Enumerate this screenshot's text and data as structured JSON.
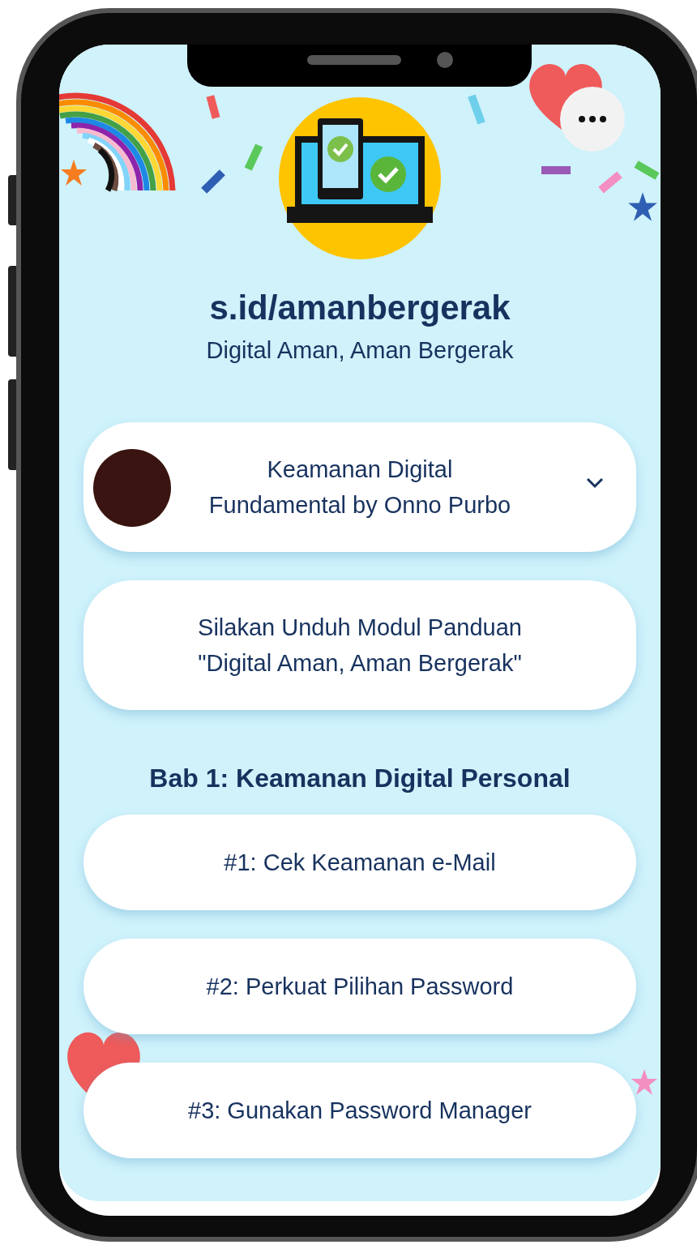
{
  "profile": {
    "handle": "s.id/amanbergerak",
    "tagline": "Digital Aman, Aman Bergerak"
  },
  "links": [
    {
      "kind": "thumbnail",
      "label": "Keamanan Digital\nFundamental by Onno Purbo",
      "expanded": false
    },
    {
      "kind": "plain",
      "label": "Silakan Unduh Modul Panduan\n\"Digital Aman, Aman Bergerak\""
    }
  ],
  "sections": [
    {
      "title": "Bab 1: Keamanan Digital Personal",
      "links": [
        {
          "kind": "plain",
          "label": "#1: Cek Keamanan e-Mail"
        },
        {
          "kind": "plain",
          "label": "#2: Perkuat Pilihan Password"
        },
        {
          "kind": "plain",
          "label": "#3: Gunakan Password Manager"
        }
      ]
    }
  ]
}
